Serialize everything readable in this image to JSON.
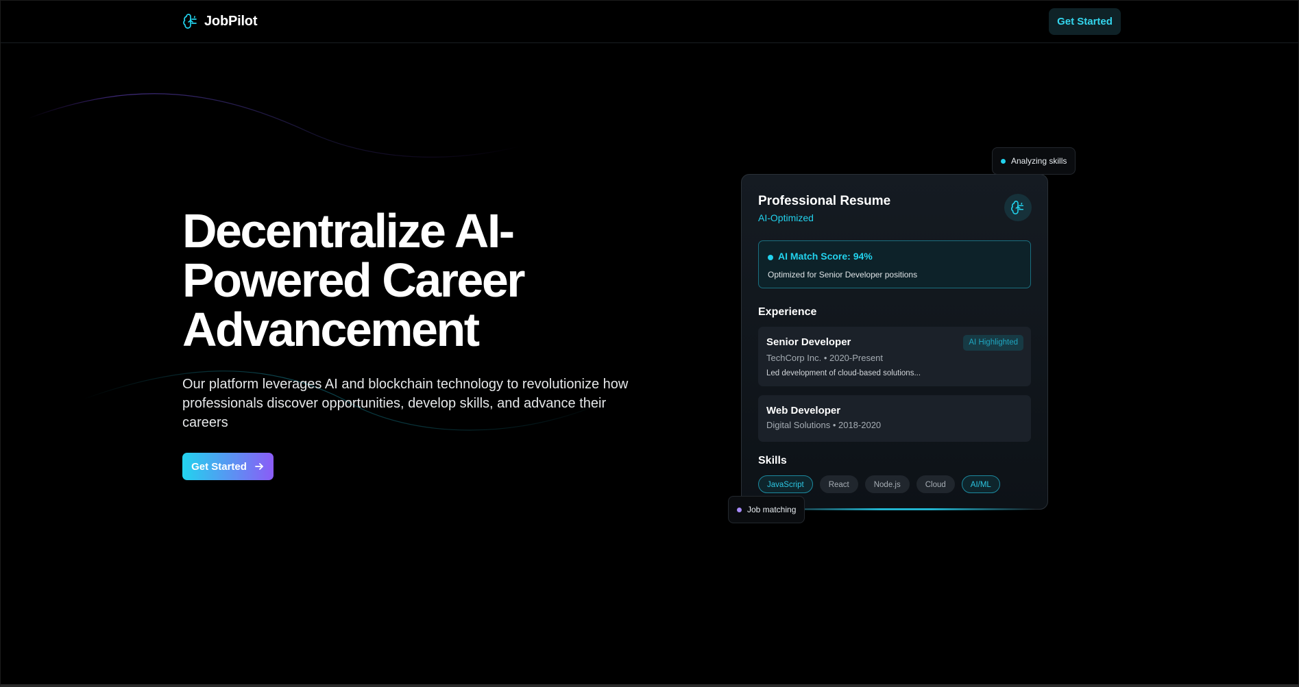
{
  "brand": {
    "name": "JobPilot",
    "icon": "brain-icon"
  },
  "nav": {
    "cta_label": "Get Started"
  },
  "hero": {
    "title_lines": [
      "Decentralize AI-",
      "Powered Career",
      "Advancement"
    ],
    "subtitle": "Our platform leverages AI and blockchain technology to revolutionize how professionals discover opportunities, develop skills, and advance their careers",
    "cta_label": "Get Started",
    "cta_icon": "arrow-right-icon"
  },
  "resume_card": {
    "title": "Professional Resume",
    "subtitle": "AI-Optimized",
    "icon": "brain-icon",
    "score": {
      "title": "AI Match Score: 94%",
      "description": "Optimized for Senior Developer positions"
    },
    "experience_label": "Experience",
    "experience": [
      {
        "role": "Senior Developer",
        "meta": "TechCorp Inc. • 2020-Present",
        "description": "Led development of cloud-based solutions...",
        "tag": "AI Highlighted"
      },
      {
        "role": "Web Developer",
        "meta": "Digital Solutions • 2018-2020"
      }
    ],
    "skills_label": "Skills",
    "skills": [
      {
        "label": "JavaScript",
        "highlighted": true
      },
      {
        "label": "React",
        "highlighted": false
      },
      {
        "label": "Node.js",
        "highlighted": false
      },
      {
        "label": "Cloud",
        "highlighted": false
      },
      {
        "label": "AI/ML",
        "highlighted": true
      }
    ]
  },
  "floating": {
    "analyzing": "Analyzing skills",
    "matching": "Job matching"
  },
  "colors": {
    "accent_cyan": "#22d3ee",
    "accent_purple": "#8b5cf6",
    "background": "#000000"
  }
}
